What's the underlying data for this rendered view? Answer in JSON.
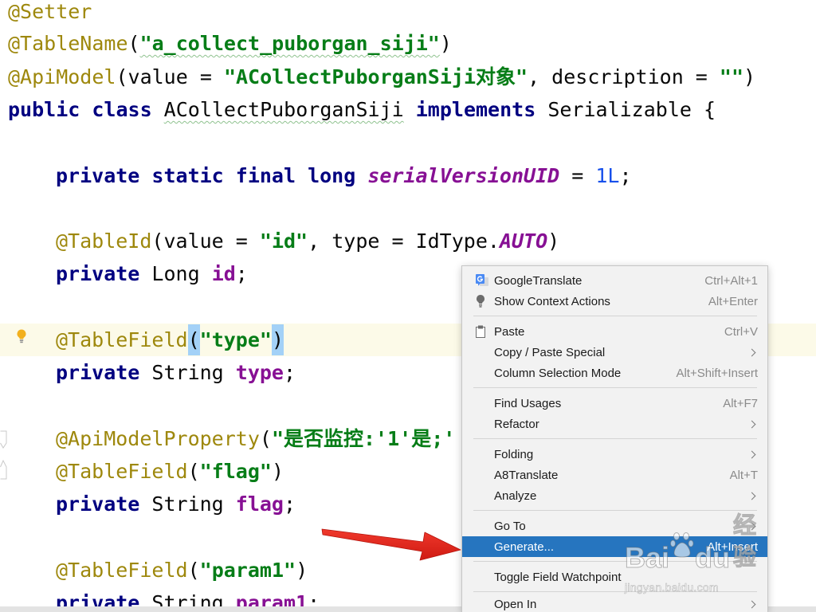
{
  "colors": {
    "annotation": "#9e880d",
    "keyword": "#000080",
    "string": "#067d17",
    "field": "#871094",
    "number": "#1750eb",
    "text": "#080808",
    "caret_row": "#fcfae8",
    "brace_match": "#a3d1f7",
    "menu_bg": "#f2f2f2",
    "menu_selection": "#2675bf",
    "arrow": "#e42a1d"
  },
  "code": [
    [
      "@Setter"
    ],
    [
      "@TableName",
      "(",
      "\"a_collect_puborgan_siji\"",
      ")"
    ],
    [
      "@ApiModel",
      "(value = ",
      "\"ACollectPuborganSiji对象\"",
      ", description = ",
      "\"\"",
      ")"
    ],
    [
      "public class ",
      "ACollectPuborganSiji",
      " implements ",
      "Serializable {"
    ],
    [
      "private static final long ",
      "serialVersionUID",
      " = ",
      "1L",
      ";"
    ],
    [
      "@TableId",
      "(value = ",
      "\"id\"",
      ", type = IdType.",
      "AUTO",
      ")"
    ],
    [
      "private ",
      "Long ",
      "id",
      ";"
    ],
    [
      "@TableField",
      "(",
      "\"type\"",
      ")"
    ],
    [
      "private ",
      "String ",
      "type",
      ";"
    ],
    [
      "@ApiModelProperty",
      "(",
      "\"是否监控:'1'是;'"
    ],
    [
      "@TableField",
      "(",
      "\"flag\"",
      ")"
    ],
    [
      "private ",
      "String ",
      "flag",
      ";"
    ],
    [
      "@TableField",
      "(",
      "\"param1\"",
      ")"
    ],
    [
      "private ",
      "String ",
      "param1",
      ";"
    ]
  ],
  "context_menu": {
    "items": [
      {
        "label": "GoogleTranslate",
        "shortcut": "Ctrl+Alt+1",
        "icon": "google-translate-icon"
      },
      {
        "label": "Show Context Actions",
        "shortcut": "Alt+Enter",
        "icon": "lightbulb-icon"
      },
      {
        "label": "Paste",
        "shortcut": "Ctrl+V",
        "icon": "clipboard-icon"
      },
      {
        "label": "Copy / Paste Special",
        "submenu": true
      },
      {
        "label": "Column Selection Mode",
        "shortcut": "Alt+Shift+Insert"
      },
      {
        "label": "Find Usages",
        "shortcut": "Alt+F7"
      },
      {
        "label": "Refactor",
        "submenu": true
      },
      {
        "label": "Folding",
        "submenu": true
      },
      {
        "label": "A8Translate",
        "shortcut": "Alt+T"
      },
      {
        "label": "Analyze",
        "submenu": true
      },
      {
        "label": "Go To",
        "submenu": true
      },
      {
        "label": "Generate...",
        "shortcut": "Alt+Insert",
        "selected": true
      },
      {
        "label": "Toggle Field Watchpoint"
      },
      {
        "label": "Open In",
        "submenu": true
      }
    ]
  },
  "watermark": {
    "brand_left": "Bai",
    "brand_right": "du",
    "brand_cn": "经验",
    "url": "jingyan.baidu.com"
  }
}
